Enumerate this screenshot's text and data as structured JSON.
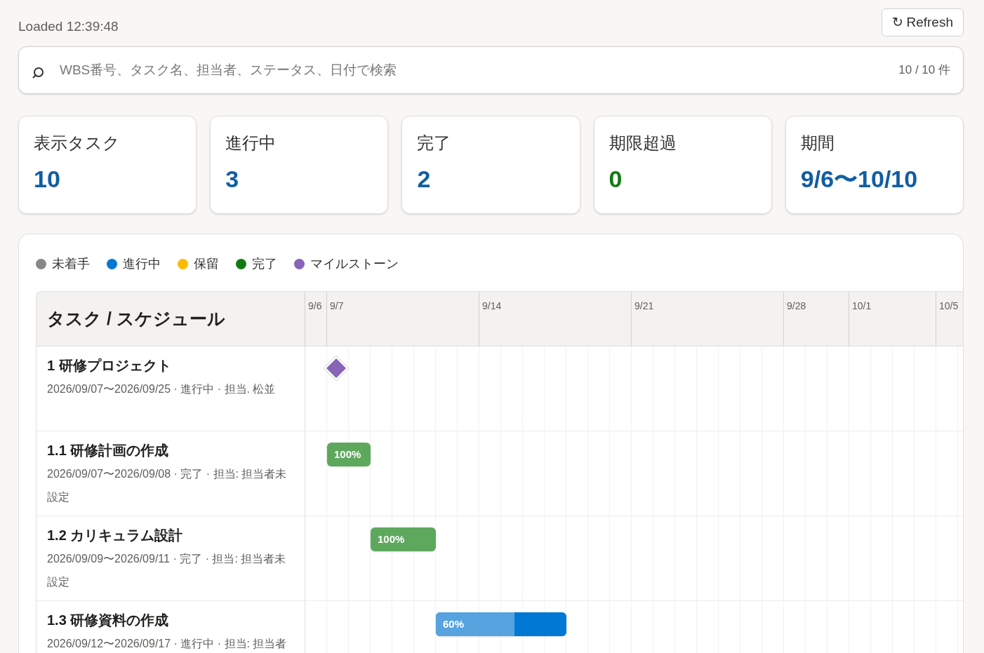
{
  "loaded": "Loaded 12:39:48",
  "refresh": {
    "icon": "↻",
    "label": "Refresh"
  },
  "search": {
    "placeholder": "WBS番号、タスク名、担当者、ステータス、日付で検索",
    "count": "10 / 10 件"
  },
  "stats": [
    {
      "label": "表示タスク",
      "value": "10",
      "color": "#115ea3"
    },
    {
      "label": "進行中",
      "value": "3",
      "color": "#115ea3"
    },
    {
      "label": "完了",
      "value": "2",
      "color": "#115ea3"
    },
    {
      "label": "期限超過",
      "value": "0",
      "color": "#107c10"
    },
    {
      "label": "期間",
      "value": "9/6〜10/10",
      "color": "#115ea3"
    }
  ],
  "legend": [
    {
      "label": "未着手",
      "color": "#8a8886"
    },
    {
      "label": "進行中",
      "color": "#0078d4"
    },
    {
      "label": "保留",
      "color": "#ffb900"
    },
    {
      "label": "完了",
      "color": "#107c10"
    },
    {
      "label": "マイルストーン",
      "color": "#8764b8"
    }
  ],
  "gantt": {
    "title": "タスク / スケジュール",
    "dates": [
      "9/6",
      "9/7",
      "9/14",
      "9/21",
      "9/28",
      "10/1",
      "10/5"
    ],
    "tasks": [
      {
        "title": "1 研修プロジェクト",
        "meta": "2026/09/07〜2026/09/25 · 進行中 · 担当. 松並",
        "kind": "milestone",
        "color": "#8764b8"
      },
      {
        "title": "1.1 研修計画の作成",
        "meta": "2026/09/07〜2026/09/08 · 完了 · 担当: 担当者未設定",
        "kind": "bar",
        "color": "#5ea85e",
        "label": "100%",
        "level": 1
      },
      {
        "title": "1.2 カリキュラム設計",
        "meta": "2026/09/09〜2026/09/11 · 完了 · 担当: 担当者未設定",
        "kind": "bar",
        "color": "#5ea85e",
        "label": "100%",
        "level": 1
      },
      {
        "title": "1.3 研修資料の作成",
        "meta": "2026/09/12〜2026/09/17 · 進行中 · 担当: 担当者",
        "kind": "bar",
        "color": "#56a3e0",
        "track": {
          "color": "#0078d4"
        },
        "label": "60%",
        "level": 0.6
      }
    ]
  }
}
